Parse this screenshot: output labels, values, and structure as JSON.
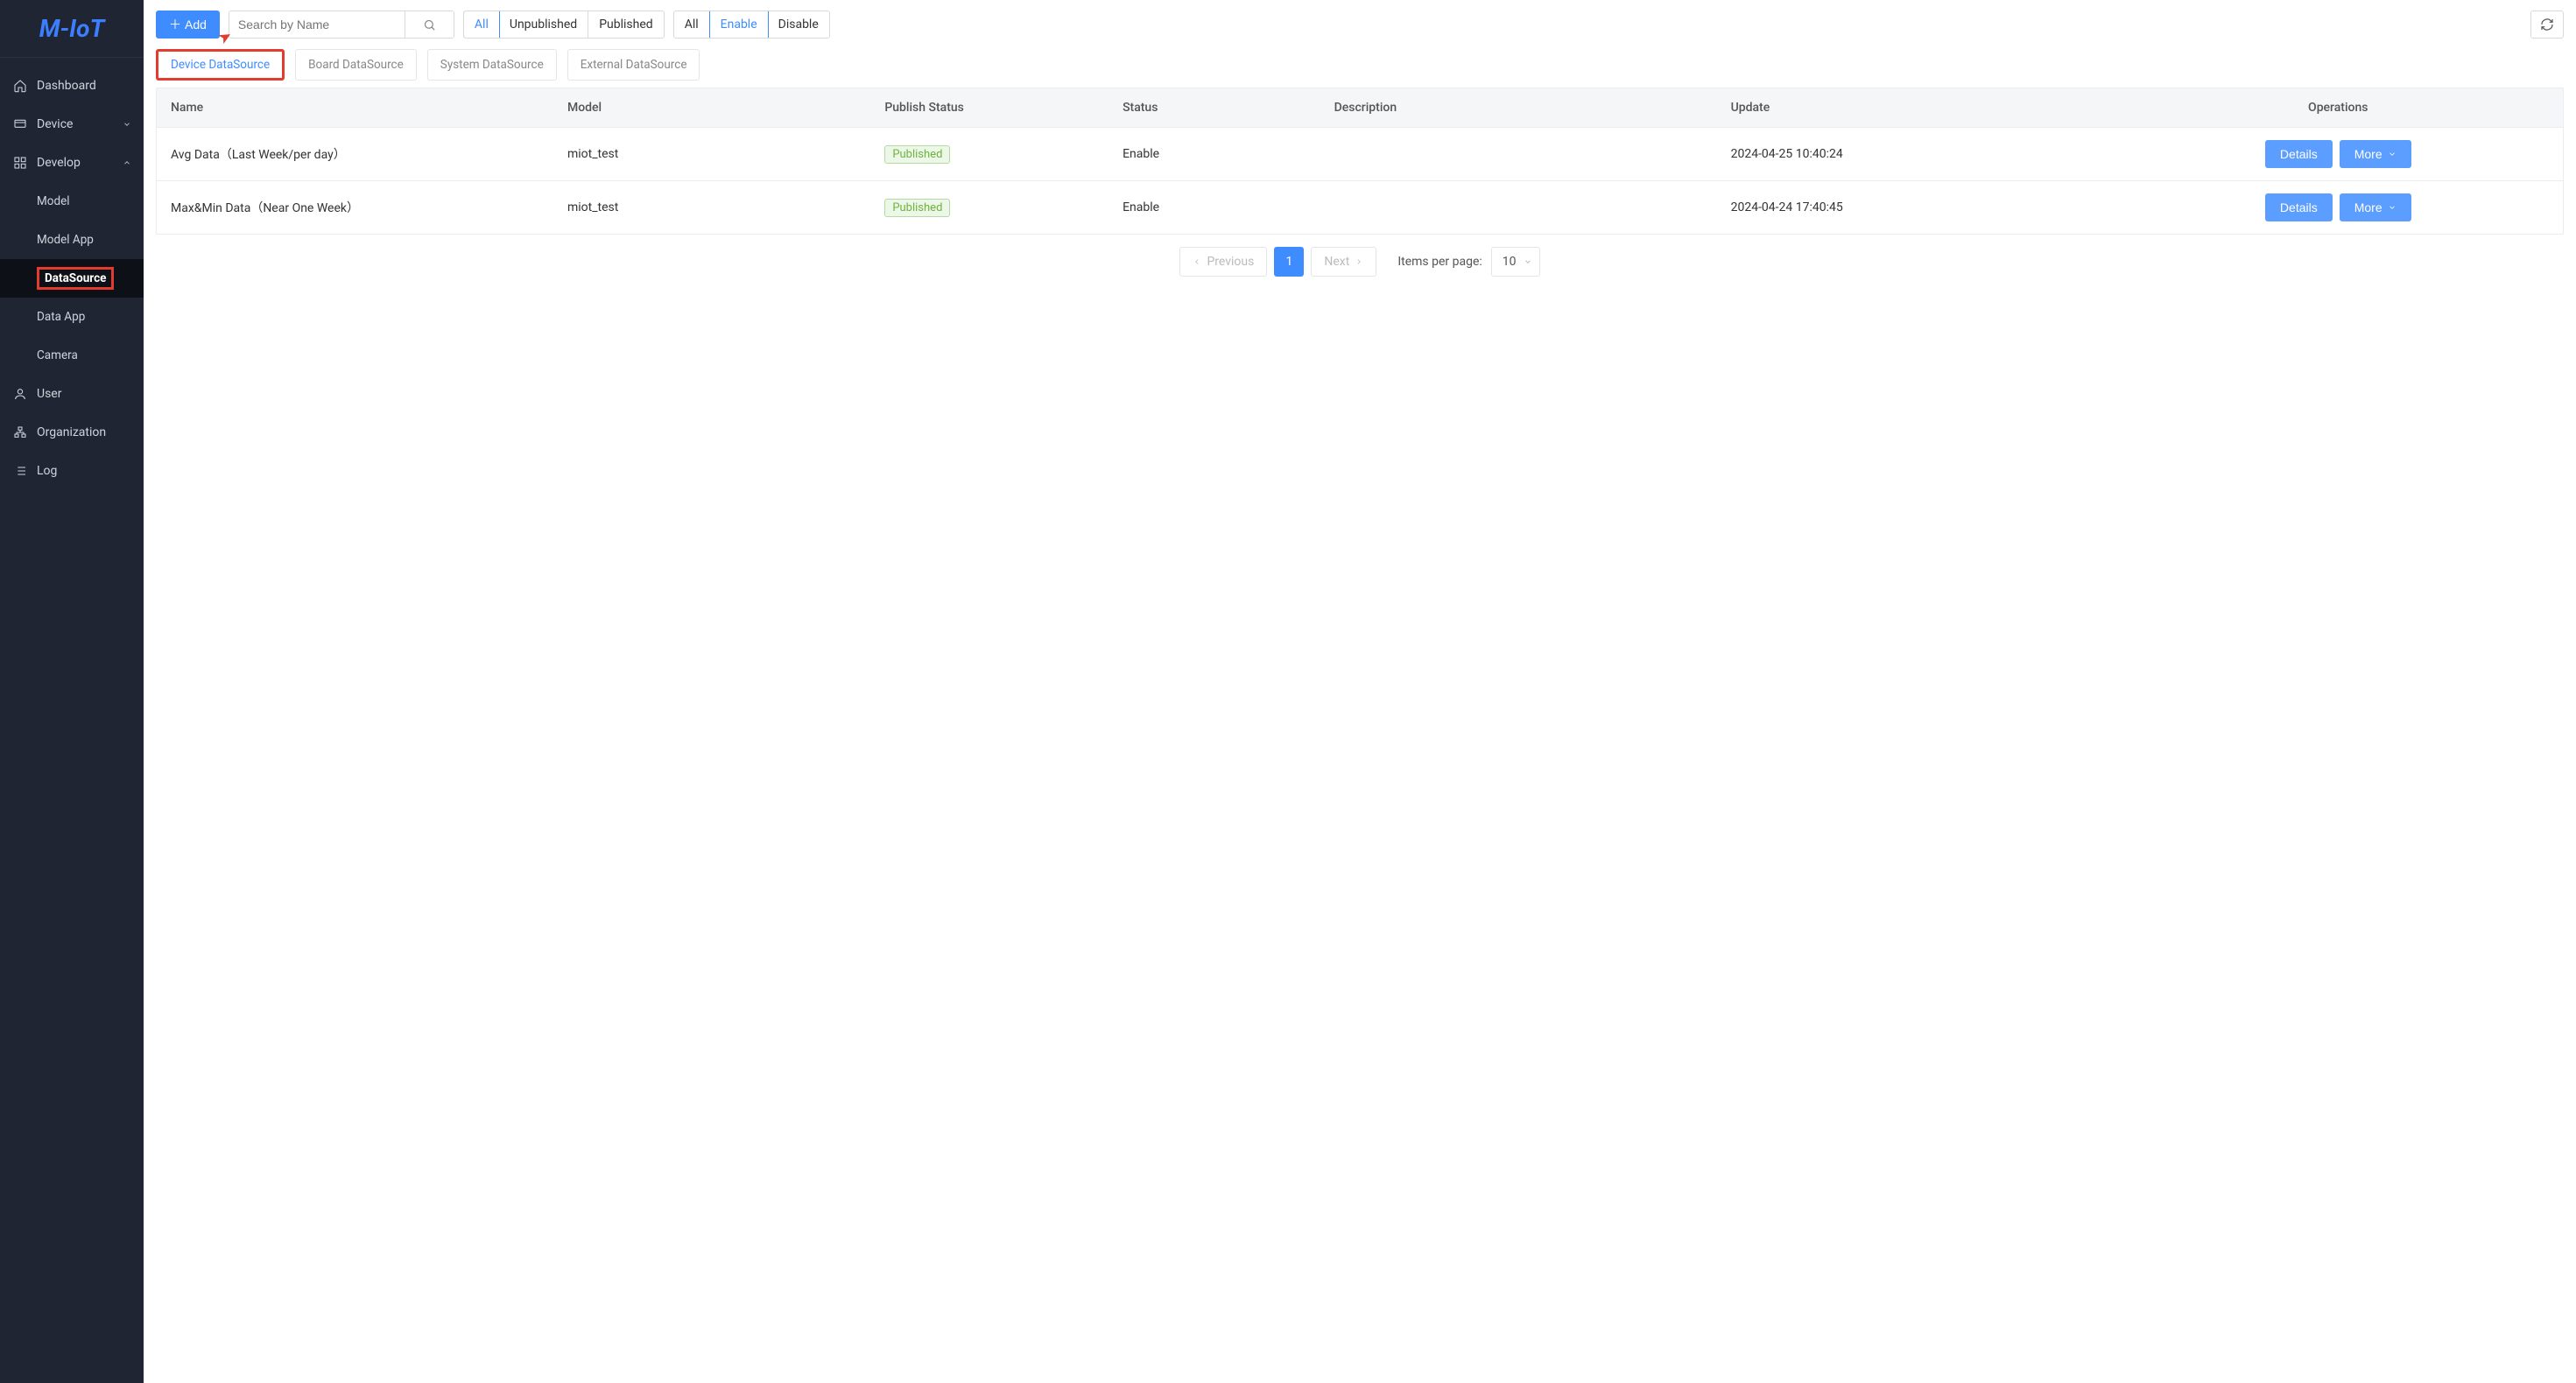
{
  "brand": "M-IoT",
  "sidebar": {
    "items": [
      {
        "label": "Dashboard",
        "icon": "home"
      },
      {
        "label": "Device",
        "icon": "device",
        "chevron": "down"
      },
      {
        "label": "Develop",
        "icon": "grid",
        "chevron": "up"
      },
      {
        "label": "User",
        "icon": "user"
      },
      {
        "label": "Organization",
        "icon": "org"
      },
      {
        "label": "Log",
        "icon": "list"
      }
    ],
    "develop_sub": [
      {
        "label": "Model"
      },
      {
        "label": "Model App"
      },
      {
        "label": "DataSource",
        "active": true,
        "highlighted": true
      },
      {
        "label": "Data App"
      },
      {
        "label": "Camera"
      }
    ]
  },
  "toolbar": {
    "add_label": "Add",
    "search_placeholder": "Search by Name",
    "publish_filter": {
      "options": [
        "All",
        "Unpublished",
        "Published"
      ],
      "active": "All"
    },
    "enable_filter": {
      "options": [
        "All",
        "Enable",
        "Disable"
      ],
      "active": "Enable"
    }
  },
  "tabs": [
    {
      "label": "Device DataSource",
      "active": true,
      "highlighted": true
    },
    {
      "label": "Board DataSource"
    },
    {
      "label": "System DataSource"
    },
    {
      "label": "External DataSource"
    }
  ],
  "table": {
    "columns": [
      "Name",
      "Model",
      "Publish Status",
      "Status",
      "Description",
      "Update",
      "Operations"
    ],
    "ops": {
      "details": "Details",
      "more": "More"
    },
    "rows": [
      {
        "name": "Avg Data（Last Week/per day）",
        "model": "miot_test",
        "publish_status": "Published",
        "status": "Enable",
        "description": "",
        "update": "2024-04-25 10:40:24"
      },
      {
        "name": "Max&Min Data（Near One Week）",
        "model": "miot_test",
        "publish_status": "Published",
        "status": "Enable",
        "description": "",
        "update": "2024-04-24 17:40:45"
      }
    ]
  },
  "pager": {
    "previous": "Previous",
    "next": "Next",
    "current": "1",
    "items_per_page_label": "Items per page:",
    "items_per_page_value": "10"
  }
}
